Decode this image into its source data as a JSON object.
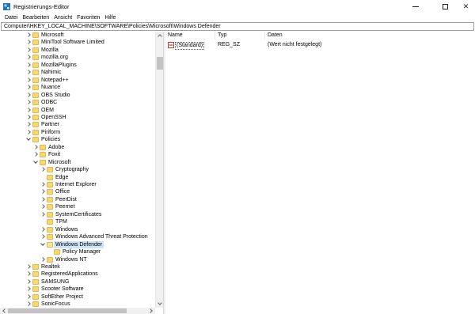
{
  "window": {
    "title": "Registrierungs-Editor",
    "close_glyph": "✕"
  },
  "menu": [
    "Datei",
    "Bearbeiten",
    "Ansicht",
    "Favoriten",
    "Hilfe"
  ],
  "address": "Computer\\HKEY_LOCAL_MACHINE\\SOFTWARE\\Policies\\Microsoft\\Windows Defender",
  "tree": [
    {
      "label": "Microsoft",
      "depth": 0,
      "expander": "right"
    },
    {
      "label": "MiniTool Software Limited",
      "depth": 0,
      "expander": "right"
    },
    {
      "label": "Mozilla",
      "depth": 0,
      "expander": "right"
    },
    {
      "label": "mozilla.org",
      "depth": 0,
      "expander": "right"
    },
    {
      "label": "MozillaPlugins",
      "depth": 0,
      "expander": "right"
    },
    {
      "label": "Nahimic",
      "depth": 0,
      "expander": "right"
    },
    {
      "label": "Notepad++",
      "depth": 0,
      "expander": "right"
    },
    {
      "label": "Nuance",
      "depth": 0,
      "expander": "right"
    },
    {
      "label": "OBS Studio",
      "depth": 0,
      "expander": "right"
    },
    {
      "label": "ODBC",
      "depth": 0,
      "expander": "right"
    },
    {
      "label": "OEM",
      "depth": 0,
      "expander": "right"
    },
    {
      "label": "OpenSSH",
      "depth": 0,
      "expander": "right"
    },
    {
      "label": "Partner",
      "depth": 0,
      "expander": "right"
    },
    {
      "label": "Piriform",
      "depth": 0,
      "expander": "right"
    },
    {
      "label": "Policies",
      "depth": 0,
      "expander": "down"
    },
    {
      "label": "Adobe",
      "depth": 1,
      "expander": "right"
    },
    {
      "label": "Foxit",
      "depth": 1,
      "expander": "right"
    },
    {
      "label": "Microsoft",
      "depth": 1,
      "expander": "down"
    },
    {
      "label": "Cryptography",
      "depth": 2,
      "expander": "right"
    },
    {
      "label": "Edge",
      "depth": 2,
      "expander": "none"
    },
    {
      "label": "Internet Explorer",
      "depth": 2,
      "expander": "right"
    },
    {
      "label": "Office",
      "depth": 2,
      "expander": "right"
    },
    {
      "label": "PeerDist",
      "depth": 2,
      "expander": "right"
    },
    {
      "label": "Peernet",
      "depth": 2,
      "expander": "right"
    },
    {
      "label": "SystemCertificates",
      "depth": 2,
      "expander": "right"
    },
    {
      "label": "TPM",
      "depth": 2,
      "expander": "none"
    },
    {
      "label": "Windows",
      "depth": 2,
      "expander": "right"
    },
    {
      "label": "Windows Advanced Threat Protection",
      "depth": 2,
      "expander": "right"
    },
    {
      "label": "Windows Defender",
      "depth": 2,
      "expander": "down",
      "selected": true,
      "open": true
    },
    {
      "label": "Policy Manager",
      "depth": 3,
      "expander": "none"
    },
    {
      "label": "Windows NT",
      "depth": 2,
      "expander": "right"
    },
    {
      "label": "Realtek",
      "depth": 0,
      "expander": "right"
    },
    {
      "label": "RegisteredApplications",
      "depth": 0,
      "expander": "right"
    },
    {
      "label": "SAMSUNG",
      "depth": 0,
      "expander": "right"
    },
    {
      "label": "Scooter Software",
      "depth": 0,
      "expander": "right"
    },
    {
      "label": "SoftEther Project",
      "depth": 0,
      "expander": "right"
    },
    {
      "label": "SonicFocus",
      "depth": 0,
      "expander": "right"
    }
  ],
  "columns": {
    "name": "Name",
    "type": "Typ",
    "data": "Daten"
  },
  "values": [
    {
      "icon": "ab",
      "name": "(Standard)",
      "type": "REG_SZ",
      "data": "(Wert nicht festgelegt)"
    }
  ]
}
